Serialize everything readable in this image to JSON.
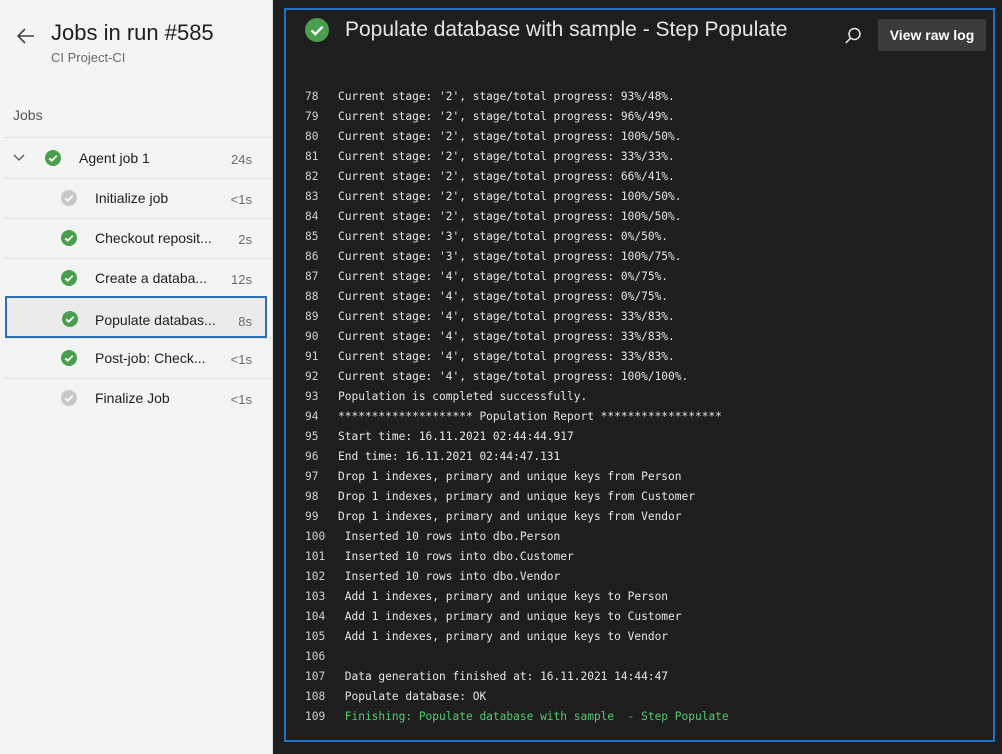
{
  "run": {
    "title": "Jobs in run #585",
    "subtitle": "CI Project-CI"
  },
  "sidebar": {
    "jobs_label": "Jobs",
    "agent_job": {
      "label": "Agent job 1",
      "time": "24s",
      "status": "succeeded"
    },
    "steps": [
      {
        "label": "Initialize job",
        "time": "<1s",
        "status": "skipped"
      },
      {
        "label": "Checkout reposit...",
        "time": "2s",
        "status": "succeeded"
      },
      {
        "label": "Create a databa...",
        "time": "12s",
        "status": "succeeded"
      },
      {
        "label": "Populate databas...",
        "time": "8s",
        "status": "succeeded",
        "selected": true
      },
      {
        "label": "Post-job: Check...",
        "time": "<1s",
        "status": "succeeded"
      },
      {
        "label": "Finalize Job",
        "time": "<1s",
        "status": "skipped"
      }
    ]
  },
  "log": {
    "title": "Populate database with sample - Step Populate",
    "view_raw_label": "View raw log",
    "lines": [
      {
        "n": "78",
        "t": "Current stage: '2', stage/total progress: 93%/48%."
      },
      {
        "n": "79",
        "t": "Current stage: '2', stage/total progress: 96%/49%."
      },
      {
        "n": "80",
        "t": "Current stage: '2', stage/total progress: 100%/50%."
      },
      {
        "n": "81",
        "t": "Current stage: '2', stage/total progress: 33%/33%."
      },
      {
        "n": "82",
        "t": "Current stage: '2', stage/total progress: 66%/41%."
      },
      {
        "n": "83",
        "t": "Current stage: '2', stage/total progress: 100%/50%."
      },
      {
        "n": "84",
        "t": "Current stage: '2', stage/total progress: 100%/50%."
      },
      {
        "n": "85",
        "t": "Current stage: '3', stage/total progress: 0%/50%."
      },
      {
        "n": "86",
        "t": "Current stage: '3', stage/total progress: 100%/75%."
      },
      {
        "n": "87",
        "t": "Current stage: '4', stage/total progress: 0%/75%."
      },
      {
        "n": "88",
        "t": "Current stage: '4', stage/total progress: 0%/75%."
      },
      {
        "n": "89",
        "t": "Current stage: '4', stage/total progress: 33%/83%."
      },
      {
        "n": "90",
        "t": "Current stage: '4', stage/total progress: 33%/83%."
      },
      {
        "n": "91",
        "t": "Current stage: '4', stage/total progress: 33%/83%."
      },
      {
        "n": "92",
        "t": "Current stage: '4', stage/total progress: 100%/100%."
      },
      {
        "n": "93",
        "t": "Population is completed successfully."
      },
      {
        "n": "94",
        "t": "******************** Population Report ******************"
      },
      {
        "n": "95",
        "t": "Start time: 16.11.2021 02:44:44.917"
      },
      {
        "n": "96",
        "t": "End time: 16.11.2021 02:44:47.131"
      },
      {
        "n": "97",
        "t": "Drop 1 indexes, primary and unique keys from Person"
      },
      {
        "n": "98",
        "t": "Drop 1 indexes, primary and unique keys from Customer"
      },
      {
        "n": "99",
        "t": "Drop 1 indexes, primary and unique keys from Vendor"
      },
      {
        "n": "100",
        "t": " Inserted 10 rows into dbo.Person"
      },
      {
        "n": "101",
        "t": " Inserted 10 rows into dbo.Customer"
      },
      {
        "n": "102",
        "t": " Inserted 10 rows into dbo.Vendor"
      },
      {
        "n": "103",
        "t": " Add 1 indexes, primary and unique keys to Person"
      },
      {
        "n": "104",
        "t": " Add 1 indexes, primary and unique keys to Customer"
      },
      {
        "n": "105",
        "t": " Add 1 indexes, primary and unique keys to Vendor"
      },
      {
        "n": "106",
        "t": ""
      },
      {
        "n": "107",
        "t": " Data generation finished at: 16.11.2021 14:44:47"
      },
      {
        "n": "108",
        "t": " Populate database: OK"
      },
      {
        "n": "109",
        "t": " Finishing: Populate database with sample  - Step Populate",
        "highlight": true
      }
    ]
  },
  "colors": {
    "success": "#4a9f4f",
    "skipped": "#c7c7c7",
    "selection": "#2d6fb4",
    "log_background": "#1e1e1e",
    "finishing_text": "#54c971"
  }
}
